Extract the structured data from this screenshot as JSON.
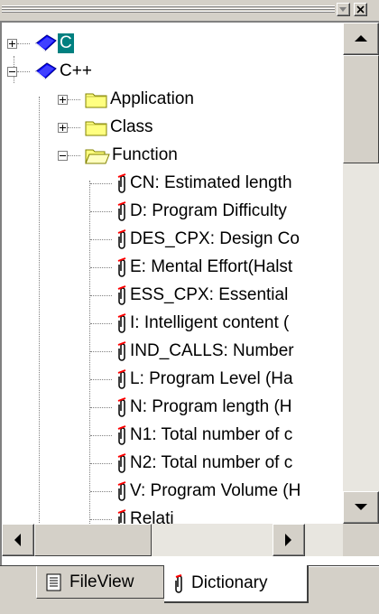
{
  "tree": {
    "roots": [
      {
        "label": "C",
        "expanded": false,
        "selected": true,
        "icon": "book-icon"
      },
      {
        "label": "C++",
        "expanded": true,
        "selected": false,
        "icon": "book-icon"
      }
    ],
    "folders": [
      {
        "label": "Application",
        "expanded": false,
        "icon": "folder-closed-icon"
      },
      {
        "label": "Class",
        "expanded": false,
        "icon": "folder-closed-icon"
      },
      {
        "label": "Function",
        "expanded": true,
        "icon": "folder-open-icon"
      }
    ],
    "metrics": [
      "CN: Estimated length",
      "D: Program Difficulty",
      "DES_CPX: Design Co",
      "E: Mental Effort(Halst",
      "ESS_CPX: Essential",
      "I: Intelligent content (",
      "IND_CALLS: Number",
      "L: Program Level (Ha",
      "N: Program length (H",
      "N1: Total number of c",
      "N2: Total number of c",
      "V: Program Volume (H",
      "    Relati"
    ],
    "metric_icon": "paperclip-icon"
  },
  "tabs": [
    {
      "label": "FileView",
      "icon": "file-view-icon",
      "active": false
    },
    {
      "label": "Dictionary",
      "icon": "paperclip-icon",
      "active": true
    }
  ],
  "scroll": {
    "vertical_position": 0.05,
    "horizontal_position": 0.0
  },
  "colors": {
    "selection": "#008080",
    "book": "#0000ff",
    "folder": "#ffff80",
    "clip": "#ff0000"
  }
}
